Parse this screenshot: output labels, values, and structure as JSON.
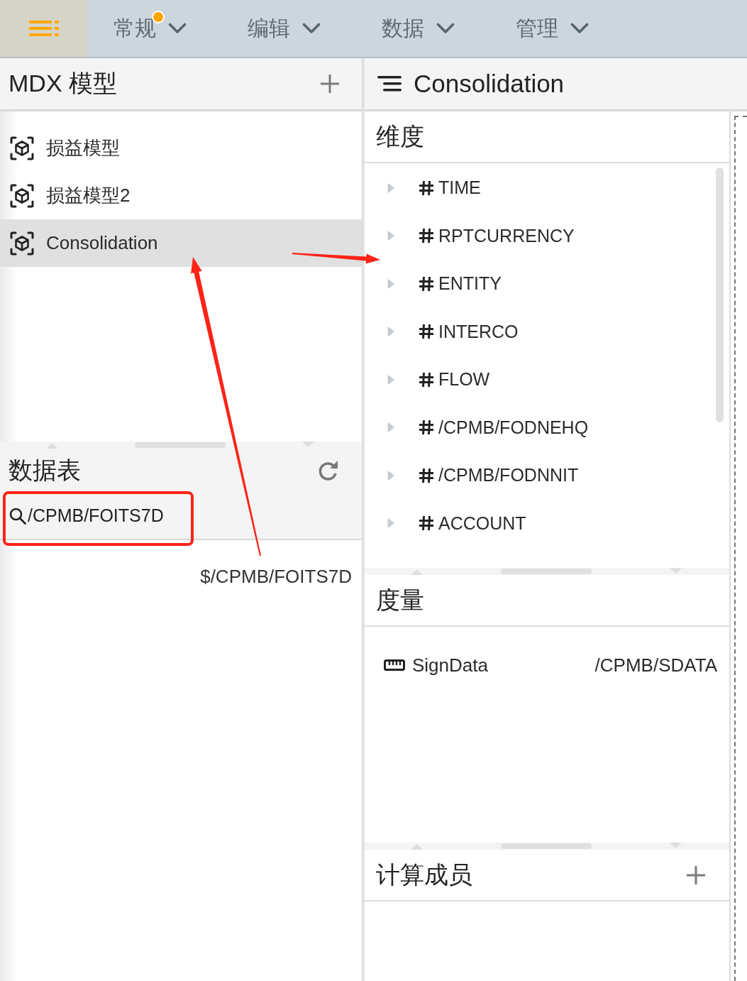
{
  "top_bar": {
    "menus": [
      {
        "label": "常规",
        "unread": true
      },
      {
        "label": "编辑",
        "unread": false
      },
      {
        "label": "数据",
        "unread": false
      },
      {
        "label": "管理",
        "unread": false
      }
    ]
  },
  "models_panel": {
    "title": "MDX 模型",
    "items": [
      {
        "label": "损益模型",
        "selected": false
      },
      {
        "label": "损益模型2",
        "selected": false
      },
      {
        "label": "Consolidation",
        "selected": true
      }
    ]
  },
  "tables_panel": {
    "title": "数据表",
    "search": {
      "value": "/CPMB/FOITS7D"
    },
    "results": [
      "$/CPMB/FOITS7D"
    ]
  },
  "model_view": {
    "title": "Consolidation",
    "dimensions": {
      "title": "维度",
      "items": [
        {
          "label": "TIME",
          "expanded": false
        },
        {
          "label": "RPTCURRENCY",
          "expanded": false
        },
        {
          "label": "ENTITY",
          "expanded": false
        },
        {
          "label": "INTERCO",
          "expanded": false
        },
        {
          "label": "FLOW",
          "expanded": false
        },
        {
          "label": "/CPMB/FODNEHQ",
          "expanded": false
        },
        {
          "label": "/CPMB/FODNNIT",
          "expanded": false
        },
        {
          "label": "ACCOUNT",
          "expanded": false
        }
      ]
    },
    "measures": {
      "title": "度量",
      "items": [
        {
          "name": "SignData",
          "technical_name": "/CPMB/SDATA"
        }
      ]
    },
    "calculated_members": {
      "title": "计算成员"
    }
  }
}
